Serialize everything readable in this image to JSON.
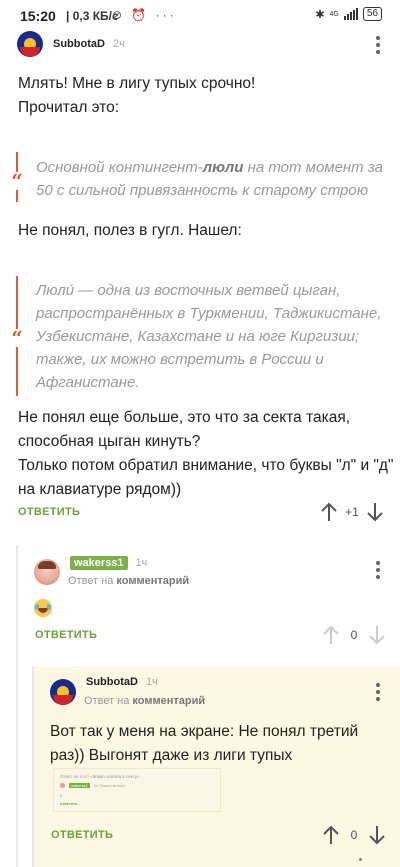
{
  "status_bar": {
    "time": "15:20",
    "speed": "0,3 КБ/с",
    "battery": "56",
    "network": "4G"
  },
  "comments": [
    {
      "author": "SubbotaD",
      "time": "2ч",
      "lines": [
        "Млять! Мне в лигу тупых срочно!",
        "Прочитал это:"
      ],
      "quote1": {
        "before": "Основной контингент-",
        "bold": "люли",
        "after": " на тот момент за 50 с сильной привязанность к старому строю"
      },
      "middle": "Не понял, полез в гугл. Нашел:",
      "quote2": "Люли́ — одна из восточных ветвей цыган, распространённых в Туркмении, Таджикистане, Узбекистане, Казахстане и на юге Киргизии; также, их можно встретить в России и Афганистане.",
      "ending": [
        "Не понял еще больше, это что за секта такая,",
        "способная цыган кинуть?",
        "Только потом обратил внимание, что буквы \"л\" и \"д\"",
        "на клавиатуре рядом))"
      ],
      "reply_label": "ОТВЕТИТЬ",
      "rating": "+1"
    },
    {
      "author": "wakerss1",
      "time": "1ч",
      "reply_prefix": "Ответ на",
      "reply_target": "комментарий",
      "reply_label": "ОТВЕТИТЬ",
      "rating": "0"
    },
    {
      "author": "SubbotaD",
      "time": "1ч",
      "reply_prefix": "Ответ на",
      "reply_target": "комментарий",
      "lines": [
        "Вот так у меня на экране: Не понял третий",
        "раз)) Выгонят даже из лиги тупых"
      ],
      "screenshot": {
        "title": "Ответ на пост «Мама попала в секту»",
        "user": "wakerss1",
        "meta": "1ч Ответ на пост",
        "body": "2",
        "reply": "ответить"
      },
      "reply_label": "ОТВЕТИТЬ",
      "rating": "0"
    }
  ],
  "colors": {
    "accent": "#6ba23a",
    "quote": "#e05a3c",
    "highlight_bg": "#fdf8e3"
  }
}
